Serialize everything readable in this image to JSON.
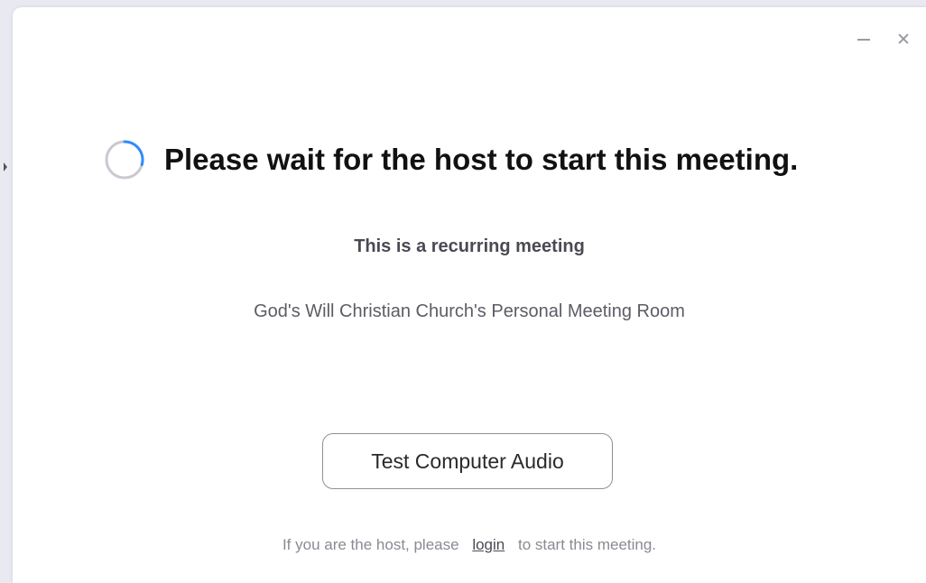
{
  "window": {
    "controls": {
      "minimize": "minimize-icon",
      "close": "close-icon"
    }
  },
  "main": {
    "title": "Please wait for the host to start this meeting.",
    "recurring_label": "This is a recurring meeting",
    "room_name": "God's Will Christian Church's Personal Meeting Room",
    "test_audio_label": "Test Computer Audio"
  },
  "footer": {
    "prefix": "If you are the host, please",
    "login_label": "login",
    "suffix": "to start this meeting."
  },
  "colors": {
    "spinner_accent": "#2d8cff",
    "spinner_track": "#c9c9d1",
    "backdrop": "#e9e9f2"
  }
}
